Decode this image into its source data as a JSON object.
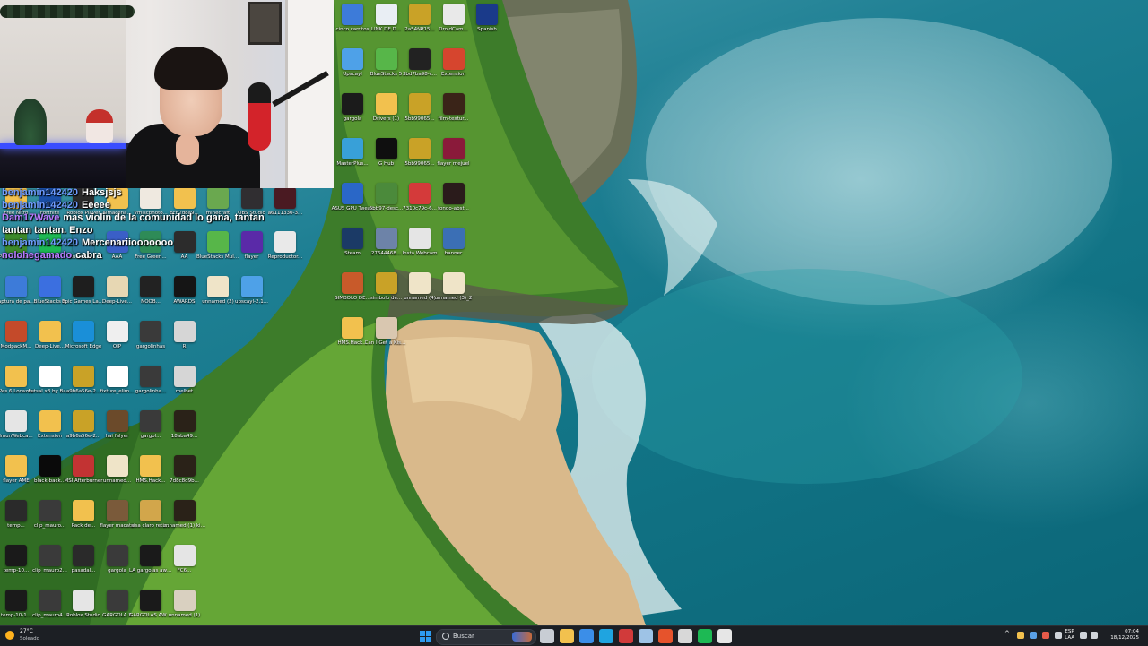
{
  "chat": {
    "messages": [
      {
        "user": "benjamin142420",
        "text": "Haksjsjs",
        "user_color": "blue"
      },
      {
        "user": "benjamin142420",
        "text": "Eeeee",
        "user_color": "blue"
      },
      {
        "user": "Dam17Wave",
        "text": "mas violin de la comunidad lo gana, tantan tantan tantan. Enzo",
        "user_color": "purple"
      },
      {
        "user": "benjamin142420",
        "text": "Mercenariiooooooo",
        "user_color": "blue"
      },
      {
        "user": "nolohegamado",
        "text": "cabra",
        "user_color": "purple"
      }
    ]
  },
  "desktop": {
    "icons_top": [
      {
        "label": "cinco carritos",
        "color": "#3d7bd9"
      },
      {
        "label": "LINK DE D...",
        "color": "#e9eef4"
      },
      {
        "label": "2a54f4f15...",
        "color": "#c9a227"
      },
      {
        "label": "DroidCam...",
        "color": "#e9e9e9"
      },
      {
        "label": "Spanish",
        "color": "#1a3a8a"
      },
      {
        "label": "Upscayl",
        "color": "#4ea1e8"
      },
      {
        "label": "BlueStacks 5",
        "color": "#57b649"
      },
      {
        "label": "3bd7ba98-c...",
        "color": "#222222"
      },
      {
        "label": "Extension",
        "color": "#d6452e"
      },
      {
        "label": "gargola",
        "color": "#1b1b1b"
      },
      {
        "label": "Drivers (1)",
        "color": "#f2c14e"
      },
      {
        "label": "5bb99065...",
        "color": "#c9a227"
      },
      {
        "label": "film-textur...",
        "color": "#3a2418"
      },
      {
        "label": "MasterPlus...",
        "color": "#38a0d8"
      },
      {
        "label": "G Hub",
        "color": "#0f0f0f"
      },
      {
        "label": "5bb99065...",
        "color": "#c9a227"
      },
      {
        "label": "flayer mejuel",
        "color": "#8a1a3a"
      },
      {
        "label": "ASUS GPU Tweak",
        "color": "#2a67c7"
      },
      {
        "label": "5bb97-desc...",
        "color": "#4b8a3b"
      },
      {
        "label": "7310c79c-6...",
        "color": "#d43a3a"
      },
      {
        "label": "fondo-abst...",
        "color": "#2a1b1b"
      },
      {
        "label": "Steam",
        "color": "#1b3a66"
      },
      {
        "label": "27644468...",
        "color": "#6d83a8"
      },
      {
        "label": "Insta Webcam",
        "color": "#e5e5e5"
      },
      {
        "label": "banner",
        "color": "#3b6fb5"
      },
      {
        "label": "SIMBOLO DE...",
        "color": "#c85a2a"
      },
      {
        "label": "simbolo de...",
        "color": "#c9a227"
      },
      {
        "label": "unnamed (4)",
        "color": "#efe4c8"
      },
      {
        "label": "unnamed (3)_2",
        "color": "#efe4c8"
      },
      {
        "label": "HMS.Hack...",
        "color": "#f2c14e"
      },
      {
        "label": "Can I Get a Kiss Mauroo",
        "color": "#d9c7b0"
      }
    ],
    "icons_left": [
      {
        "label": "Free Nitro",
        "color": "#f2c14e"
      },
      {
        "label": "Fortnite",
        "color": "#1a4fa8"
      },
      {
        "label": "Roblox Player",
        "color": "#2a2a2a"
      },
      {
        "label": "Almacena...",
        "color": "#f2c14e"
      },
      {
        "label": "Vmiscphoto...",
        "color": "#efe9e0"
      },
      {
        "label": "bcb2d8a9...",
        "color": "#f2c14e"
      },
      {
        "label": "minecraft",
        "color": "#6aa84f"
      },
      {
        "label": "OBS Studio",
        "color": "#302e31"
      },
      {
        "label": "a6111330-3...",
        "color": "#4a1a22"
      },
      {
        "label": "Pes 6 Locazos",
        "color": "#3d8a2b"
      },
      {
        "label": "Spotify",
        "color": "#1db954"
      },
      {
        "label": "Rueda-de...",
        "color": "#2c7a9c"
      },
      {
        "label": "AAA",
        "color": "#3a5fc7"
      },
      {
        "label": "Free Green...",
        "color": "#2e8b57"
      },
      {
        "label": "AA",
        "color": "#2c2c2c"
      },
      {
        "label": "BlueStacks Multi-Insta...",
        "color": "#57b649"
      },
      {
        "label": "flayer",
        "color": "#5a2aa8"
      },
      {
        "label": "Reproductor...",
        "color": "#e9e9e9"
      },
      {
        "label": "Captura de pantalla",
        "color": "#3d7bd9"
      },
      {
        "label": "BlueStacks X",
        "color": "#3b6fe0"
      },
      {
        "label": "Epic Games Launcher",
        "color": "#1e1e1e"
      },
      {
        "label": "Deep-Live...",
        "color": "#e7d7b3"
      },
      {
        "label": "NOOB...",
        "color": "#222222"
      },
      {
        "label": "AWARDS",
        "color": "#151515"
      },
      {
        "label": "unnamed (2)",
        "color": "#efe4c8"
      },
      {
        "label": "upscayl-2.1...",
        "color": "#4ea1e8"
      },
      {
        "label": "ModpackM...",
        "color": "#c44a2a"
      },
      {
        "label": "Deep-Live...",
        "color": "#f2c14e"
      },
      {
        "label": "Microsoft Edge",
        "color": "#1a8fd8"
      },
      {
        "label": "OIP",
        "color": "#efefef"
      },
      {
        "label": "gargolinhas",
        "color": "#3a3a3a"
      },
      {
        "label": "R",
        "color": "#d6d6d6"
      },
      {
        "label": "Pes 6 Locazos",
        "color": "#f2c14e"
      },
      {
        "label": "Futsal x3 by Bazinga fro...",
        "color": "#ffffff"
      },
      {
        "label": "a9b6a56e-2...",
        "color": "#c9a227"
      },
      {
        "label": "fixture_elim...",
        "color": "#ffffff"
      },
      {
        "label": "gargolinha...",
        "color": "#3a3a3a"
      },
      {
        "label": "melbet",
        "color": "#d6d6d6"
      },
      {
        "label": "ImunWebca...",
        "color": "#e5e5e5"
      },
      {
        "label": "Extension",
        "color": "#f2c14e"
      },
      {
        "label": "a9b6a56e-2...",
        "color": "#c9a227"
      },
      {
        "label": "hai falyer",
        "color": "#6b4a2a"
      },
      {
        "label": "gargol...",
        "color": "#3a3a3a"
      },
      {
        "label": "18aba49...",
        "color": "#2a2218"
      },
      {
        "label": "flayer AME",
        "color": "#f2c14e"
      },
      {
        "label": "black-back...",
        "color": "#0a0a0a"
      },
      {
        "label": "MSI Afterburner",
        "color": "#c23333"
      },
      {
        "label": "unnamed...",
        "color": "#efe4c8"
      },
      {
        "label": "HMS.Hack...",
        "color": "#f2c14e"
      },
      {
        "label": "7d8c8d9b...",
        "color": "#2a2218"
      },
      {
        "label": "temp...",
        "color": "#2a2a2a"
      },
      {
        "label": "clip_mauro...",
        "color": "#3a3a3a"
      },
      {
        "label": "Pack de...",
        "color": "#f2c14e"
      },
      {
        "label": "flayer macate",
        "color": "#7a5a3a"
      },
      {
        "label": "sisa claro retir...",
        "color": "#d2a64b"
      },
      {
        "label": "unnamed (1) kiss maur...",
        "color": "#2a2218"
      },
      {
        "label": "temp-10...",
        "color": "#1a1a1a"
      },
      {
        "label": "clip_mauro2...",
        "color": "#3a3a3a"
      },
      {
        "label": "pasadal...",
        "color": "#2a2a2a"
      },
      {
        "label": "gargola",
        "color": "#3a3a3a"
      },
      {
        "label": "LA gargolas awards",
        "color": "#1a1a1a"
      },
      {
        "label": "FC6...",
        "color": "#e5e5e5"
      },
      {
        "label": "temp-10-1...",
        "color": "#1a1a1a"
      },
      {
        "label": "clip_mauro4...",
        "color": "#3a3a3a"
      },
      {
        "label": "Roblox Studio",
        "color": "#e5e5e5"
      },
      {
        "label": "GARGOLA 3",
        "color": "#3a3a3a"
      },
      {
        "label": "GARGOLAS AWARDS",
        "color": "#1a1a1a"
      },
      {
        "label": "unnamed (1)",
        "color": "#d9d0c0"
      }
    ]
  },
  "taskbar": {
    "weather": {
      "temp": "27°C",
      "condition": "Soleado"
    },
    "search_placeholder": "Buscar",
    "apps": [
      {
        "name": "task-view-icon",
        "color": "#c8cdd4"
      },
      {
        "name": "file-explorer-icon",
        "color": "#f2c14e"
      },
      {
        "name": "store-icon",
        "color": "#3b8ee8"
      },
      {
        "name": "edge-icon",
        "color": "#1fa4e0"
      },
      {
        "name": "media-icon",
        "color": "#d13a3a"
      },
      {
        "name": "steam-icon",
        "color": "#9ec3e6"
      },
      {
        "name": "brave-icon",
        "color": "#e6532c"
      },
      {
        "name": "obs-icon",
        "color": "#d8d8d8"
      },
      {
        "name": "spotify-icon",
        "color": "#1db954"
      },
      {
        "name": "player-icon",
        "color": "#e6e6e6"
      }
    ],
    "language": {
      "code": "ESP",
      "layout": "LAA"
    },
    "clock": {
      "time": "07:04",
      "date": "18/12/2025"
    }
  }
}
